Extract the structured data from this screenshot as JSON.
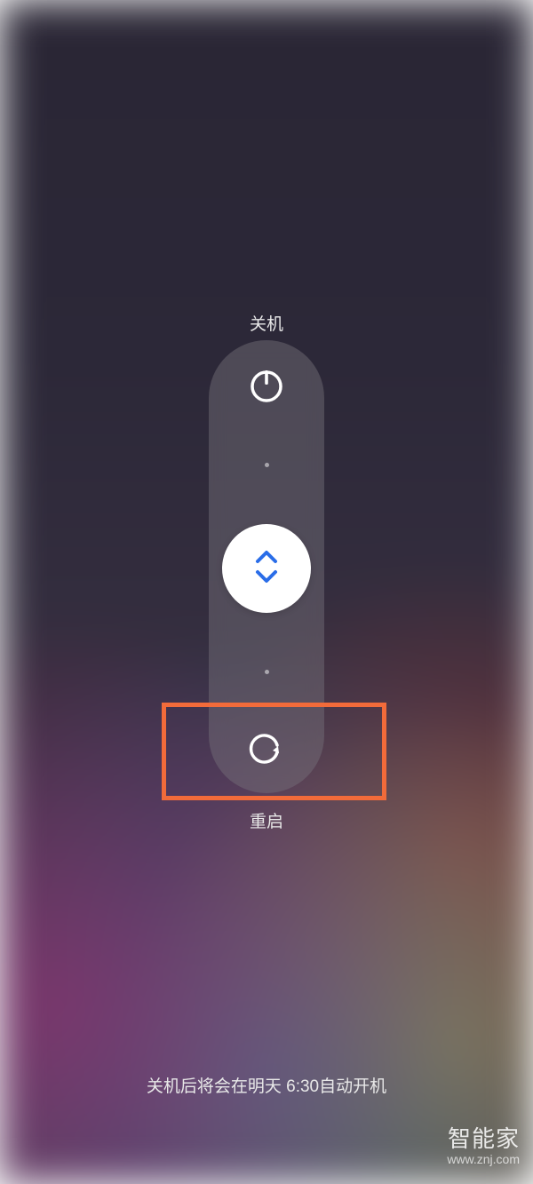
{
  "labels": {
    "shutdown": "关机",
    "restart": "重启"
  },
  "hint": "关机后将会在明天 6:30自动开机",
  "watermark": {
    "title": "智能家",
    "url": "www.znj.com"
  },
  "icons": {
    "power": "power-icon",
    "slider": "slider-arrows-icon",
    "restart": "restart-icon"
  },
  "colors": {
    "highlight": "#f26b3a",
    "slider_arrow": "#2a6de8",
    "icon_stroke": "#ffffff"
  }
}
